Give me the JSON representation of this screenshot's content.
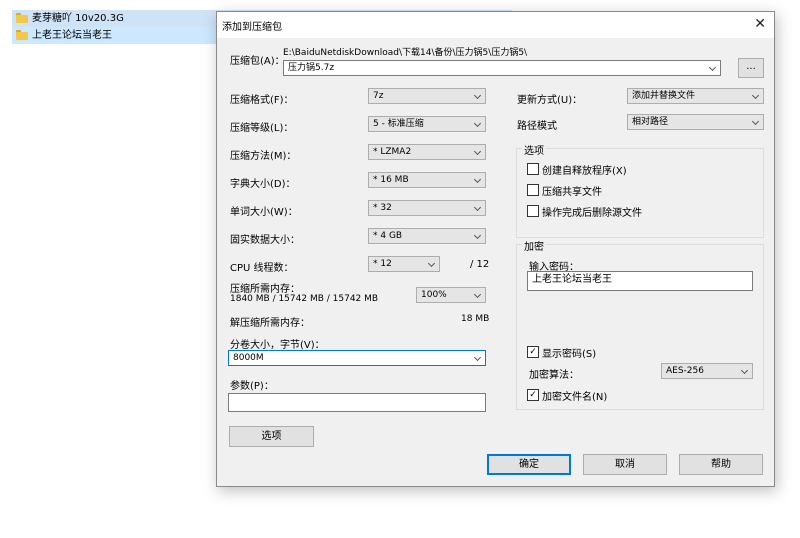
{
  "background_files": [
    {
      "name": "麦芽糖吖 10v20.3G"
    },
    {
      "name": "上老王论坛当老王"
    }
  ],
  "dialog": {
    "title": "添加到压缩包",
    "close_glyph": "✕",
    "archive_label": "压缩包(A)：",
    "archive_path": "E:\\BaiduNetdiskDownload\\下载14\\备份\\压力锅5\\压力锅5\\",
    "archive_name": "压力锅5.7z",
    "browse_label": "...",
    "left": {
      "format_label": "压缩格式(F)：",
      "format_value": "7z",
      "level_label": "压缩等级(L)：",
      "level_value": "5 - 标准压缩",
      "method_label": "压缩方法(M)：",
      "method_value": "* LZMA2",
      "dict_label": "字典大小(D)：",
      "dict_value": "* 16 MB",
      "word_label": "单词大小(W)：",
      "word_value": "* 32",
      "solid_label": "固实数据大小：",
      "solid_value": "* 4 GB",
      "cpu_label": "CPU 线程数：",
      "cpu_value": "* 12",
      "cpu_total": "/ 12",
      "mem_label": "压缩所需内存：",
      "mem_detail": "1840 MB / 15742 MB / 15742 MB",
      "mem_percent": "100%",
      "decomp_label": "解压缩所需内存：",
      "decomp_value": "18 MB",
      "split_label": "分卷大小，字节(V)：",
      "split_value": "8000M",
      "params_label": "参数(P)：",
      "params_value": "",
      "options_button": "选项"
    },
    "right": {
      "update_label": "更新方式(U)：",
      "update_value": "添加并替换文件",
      "pathmode_label": "路径模式",
      "pathmode_value": "相对路径",
      "options_group": "选项",
      "opt_sfx": "创建自释放程序(X)",
      "opt_shared": "压缩共享文件",
      "opt_delete": "操作完成后删除源文件",
      "encrypt_group": "加密",
      "password_label": "输入密码：",
      "password_value": "上老王论坛当老王",
      "show_password": "显示密码(S)",
      "enc_method_label": "加密算法：",
      "enc_method_value": "AES-256",
      "encrypt_names": "加密文件名(N)",
      "check_glyph": "✓"
    },
    "buttons": {
      "ok": "确定",
      "cancel": "取消",
      "help": "帮助"
    }
  }
}
